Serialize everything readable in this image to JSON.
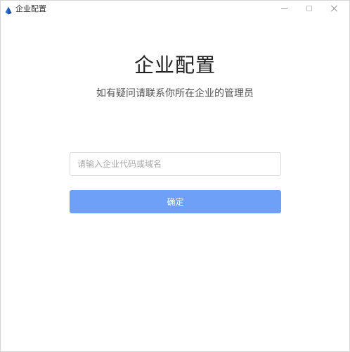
{
  "window": {
    "title": "企业配置",
    "controls": {
      "minimize": "minimize-icon",
      "maximize": "maximize-icon",
      "close": "close-icon"
    }
  },
  "main": {
    "heading": "企业配置",
    "subheading": "如有疑问请联系你所在企业的管理员",
    "input": {
      "value": "",
      "placeholder": "请输入企业代码或域名"
    },
    "confirm_label": "确定"
  },
  "colors": {
    "accent": "#6ea0f7",
    "app_icon": "#2f6fd1"
  }
}
